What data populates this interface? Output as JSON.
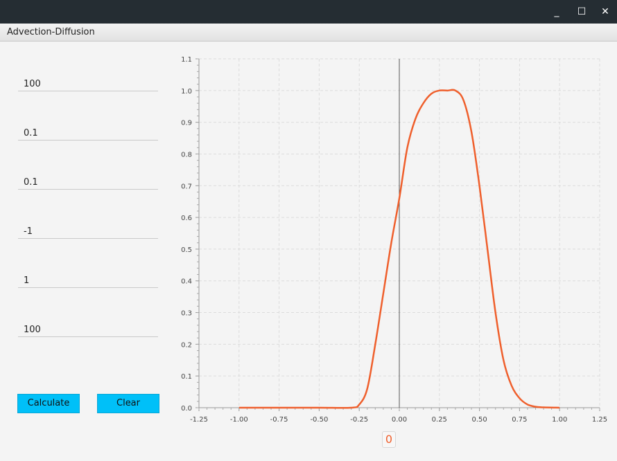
{
  "window": {
    "minimize_glyph": "_",
    "maximize_glyph": "☐",
    "close_glyph": "✕",
    "title": "Advection-Diffusion"
  },
  "inputs": [
    {
      "value": "100"
    },
    {
      "value": "0.1"
    },
    {
      "value": "0.1"
    },
    {
      "value": "-1"
    },
    {
      "value": "1"
    },
    {
      "value": "100"
    }
  ],
  "buttons": {
    "calculate_label": "Calculate",
    "clear_label": "Clear"
  },
  "colors": {
    "accent_button": "#00c0f8",
    "series": "#ef5f2c",
    "titlebar": "#252d33"
  },
  "chart_data": {
    "type": "line",
    "title": "",
    "xlabel": "",
    "ylabel": "",
    "xlim": [
      -1.25,
      1.25
    ],
    "ylim": [
      0.0,
      1.1
    ],
    "x_ticks": [
      "-1.25",
      "-1.00",
      "-0.75",
      "-0.50",
      "-0.25",
      "0.00",
      "0.25",
      "0.50",
      "0.75",
      "1.00",
      "1.25"
    ],
    "y_ticks": [
      "0.0",
      "0.1",
      "0.2",
      "0.3",
      "0.4",
      "0.5",
      "0.6",
      "0.7",
      "0.8",
      "0.9",
      "1.0",
      "1.1"
    ],
    "grid": true,
    "legend": "bottom-center",
    "series": [
      {
        "name": "0",
        "x": [
          -1.0,
          -0.75,
          -0.5,
          -0.3,
          -0.25,
          -0.2,
          -0.15,
          -0.1,
          -0.05,
          0.0,
          0.05,
          0.1,
          0.15,
          0.2,
          0.25,
          0.3,
          0.35,
          0.4,
          0.45,
          0.5,
          0.55,
          0.6,
          0.65,
          0.7,
          0.75,
          0.8,
          0.85,
          0.9,
          1.0
        ],
        "y": [
          0.0,
          0.0,
          0.0,
          0.0,
          0.01,
          0.06,
          0.2,
          0.36,
          0.52,
          0.66,
          0.82,
          0.91,
          0.96,
          0.99,
          1.0,
          1.0,
          1.0,
          0.97,
          0.87,
          0.7,
          0.5,
          0.3,
          0.15,
          0.07,
          0.03,
          0.01,
          0.003,
          0.001,
          0.0
        ]
      }
    ]
  }
}
